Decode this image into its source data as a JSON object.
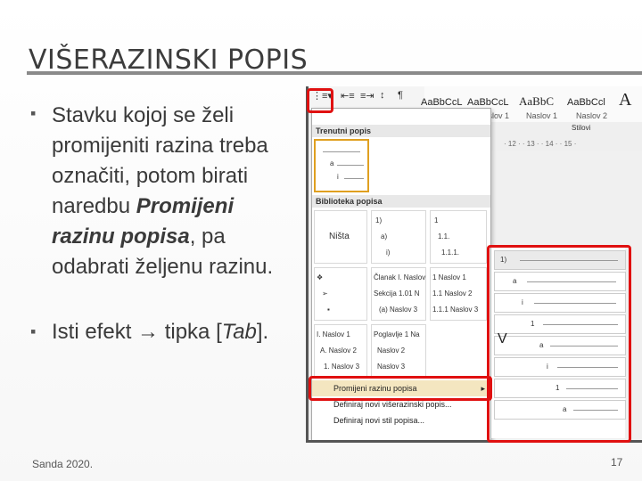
{
  "slide": {
    "title": "VIŠERAZINSKI POPIS",
    "bullets": [
      {
        "lines": [
          "Stavku kojoj se želi",
          "promijeniti razina treba",
          "označiti,  potom birati",
          "naredbu ",
          "razinu popisa",
          "odabrati željenu razinu."
        ],
        "bold_a": "Promijeni",
        "bold_b": "razinu popisa",
        "after_bold": ", pa"
      },
      {
        "pre": "Isti efekt → tipka [",
        "key": "Tab",
        "post": "]."
      }
    ],
    "footer": "Sanda 2020.",
    "page_number": "17"
  },
  "screenshot": {
    "styles": [
      {
        "sample": "AaBbCcL",
        "label": ""
      },
      {
        "sample": "AaBbCcL",
        "label": "Naslov 1"
      },
      {
        "sample": "AaBbC",
        "label": "Naslov 1"
      },
      {
        "sample": "AaBbCcl",
        "label": "Naslov 2"
      }
    ],
    "style_row_label": "Stilovi",
    "current_list_header": "Trenutni popis",
    "library_header": "Biblioteka popisa",
    "none_label": "Ništa",
    "lib_cells": [
      [
        "1)",
        "a)",
        "i)"
      ],
      [
        "1",
        "1.1.",
        "1.1.1."
      ],
      [
        "Članak I. Naslov",
        "Sekcija 1.01 N",
        "(a) Naslov 3"
      ],
      [
        "1 Naslov 1",
        "1.1 Naslov 2",
        "1.1.1 Naslov 3"
      ],
      [
        "I. Naslov 1",
        "A. Naslov 2",
        "1. Naslov 3"
      ],
      [
        "Poglavlje 1 Na",
        "Naslov 2",
        "Naslov 3"
      ]
    ],
    "menu": {
      "change_level": "Promijeni razinu popisa",
      "define_new_multilevel": "Definiraj novi višerazinski popis...",
      "define_new_style": "Definiraj novi stil popisa..."
    },
    "preview_levels": [
      "1)",
      "a",
      "i",
      "1",
      "a",
      "i",
      "1",
      "a"
    ],
    "v_mark": "V",
    "accent_color": "#e01010"
  }
}
